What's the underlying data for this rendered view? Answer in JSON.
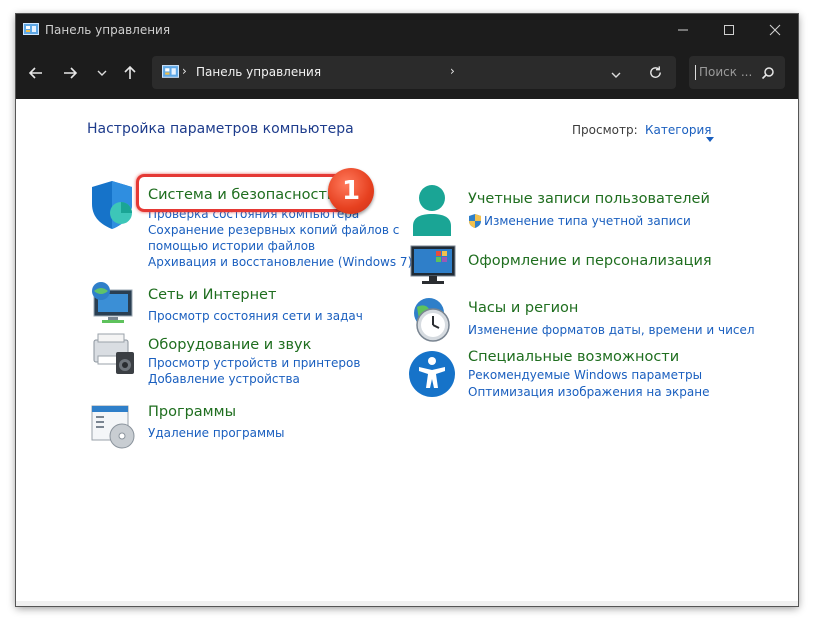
{
  "window": {
    "title": "Панель управления",
    "minimize_icon": "minimize-icon",
    "maximize_icon": "maximize-icon",
    "close_icon": "close-icon"
  },
  "toolbar": {
    "back_icon": "arrow-left-icon",
    "forward_icon": "arrow-right-icon",
    "recent_icon": "chevron-down-icon",
    "up_icon": "arrow-up-icon",
    "address": {
      "path": "Панель управления"
    },
    "search": {
      "placeholder": "Поиск ..."
    }
  },
  "main": {
    "heading": "Настройка параметров компьютера",
    "view_label": "Просмотр:",
    "view_value": "Категория"
  },
  "categories_left": [
    {
      "title": "Система и безопасность",
      "links": [
        "Проверка состояния компьютера",
        "Сохранение резервных копий файлов с",
        "помощью истории файлов",
        "Архивация и восстановление (Windows 7)"
      ]
    },
    {
      "title": "Сеть и Интернет",
      "links": [
        "Просмотр состояния сети и задач"
      ]
    },
    {
      "title": "Оборудование и звук",
      "links": [
        "Просмотр устройств и принтеров",
        "Добавление устройства"
      ]
    },
    {
      "title": "Программы",
      "links": [
        "Удаление программы"
      ]
    }
  ],
  "categories_right": [
    {
      "title": "Учетные записи пользователей",
      "links": [
        "Изменение типа учетной записи"
      ]
    },
    {
      "title": "Оформление и персонализация",
      "links": []
    },
    {
      "title": "Часы и регион",
      "links": [
        "Изменение форматов даты, времени и чисел"
      ]
    },
    {
      "title": "Специальные возможности",
      "links": [
        "Рекомендуемые Windows параметры",
        "Оптимизация изображения на экране"
      ]
    }
  ],
  "annotation": {
    "badge": "1",
    "color": "#e53935"
  },
  "colors": {
    "titlebar": "#1c1c1c",
    "link": "#1a5fbf",
    "category_title": "#1f6e1f",
    "heading": "#1e3c8c"
  }
}
